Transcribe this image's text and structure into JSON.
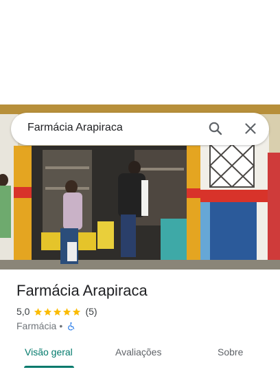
{
  "search": {
    "query": "Farmácia Arapiraca",
    "search_icon": "search-icon",
    "close_icon": "close-icon"
  },
  "place": {
    "name": "Farmácia Arapiraca",
    "rating": "5,0",
    "stars": 5,
    "reviews": "(5)",
    "category": "Farmácia",
    "separator": "•",
    "accessibility_icon": "wheelchair-icon"
  },
  "tabs": [
    {
      "label": "Visão geral",
      "active": true
    },
    {
      "label": "Avaliações",
      "active": false
    },
    {
      "label": "Sobre",
      "active": false
    }
  ],
  "colors": {
    "accent": "#00796b",
    "star": "#fbbc04",
    "a11y_icon": "#1a73e8"
  }
}
